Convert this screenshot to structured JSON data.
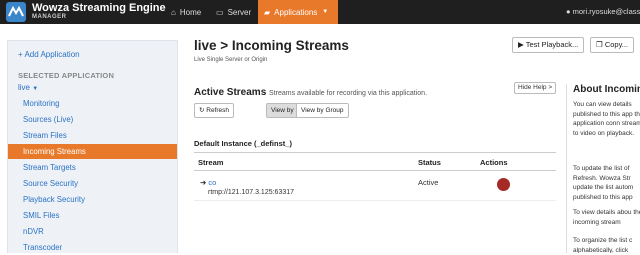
{
  "header": {
    "brand": "Wowza Streaming Engine",
    "brand_sub": "MANAGER",
    "nav": [
      {
        "label": "Home",
        "icon": "home-icon"
      },
      {
        "label": "Server",
        "icon": "monitor-icon"
      },
      {
        "label": "Applications",
        "icon": "folder-icon",
        "active": true
      }
    ],
    "user": "mori.ryosuke@classmetho"
  },
  "sidebar": {
    "add_application": "Add Application",
    "selected_label": "SELECTED APPLICATION",
    "app_name": "live",
    "items": [
      {
        "label": "Monitoring"
      },
      {
        "label": "Sources (Live)"
      },
      {
        "label": "Stream Files"
      },
      {
        "label": "Incoming Streams",
        "active": true
      },
      {
        "label": "Stream Targets"
      },
      {
        "label": "Source Security"
      },
      {
        "label": "Playback Security"
      },
      {
        "label": "SMIL Files"
      },
      {
        "label": "nDVR"
      },
      {
        "label": "Transcoder"
      }
    ]
  },
  "main": {
    "title": "live > Incoming Streams",
    "subtitle": "Live Single Server or Origin",
    "test_playback": "Test Playback...",
    "copy": "Copy...",
    "section_title": "Active Streams",
    "section_desc": "Streams available for recording via this application.",
    "hide_help": "Hide Help >",
    "refresh": "Refresh",
    "view_by_stream": "View by Stream",
    "view_by_group": "View by Group",
    "instance": "Default Instance (_definst_)",
    "columns": [
      "Stream",
      "Status",
      "Actions"
    ],
    "rows": [
      {
        "stream": "co",
        "url": "rtmp://121.107.3.125:63317",
        "status": "Active"
      }
    ]
  },
  "help": {
    "title": "About Incoming",
    "p1": "You can view details published to this app this application conn streams to video on playback.",
    "p2a": "To update the list of",
    "p2b": "Refresh. Wowza Str update the list autom published to this app",
    "p3": "To view details abou the incoming stream",
    "p4": "To organize the list c alphabetically, click"
  },
  "colors": {
    "accent": "#e8792b",
    "link": "#2a72c3",
    "topbar": "#1f1f1f",
    "stop": "#a52a26"
  }
}
